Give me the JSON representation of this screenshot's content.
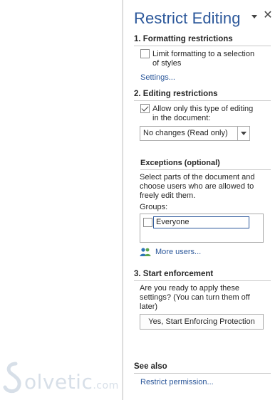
{
  "pane": {
    "title": "Restrict Editing",
    "menu_icon": "chevron-down-icon",
    "close_icon": "close-icon",
    "close_glyph": "✕"
  },
  "formatting": {
    "heading": "1. Formatting restrictions",
    "limit_checked": false,
    "limit_line1": "Limit formatting to a selection",
    "limit_line2": "of styles",
    "settings_link": "Settings..."
  },
  "editing": {
    "heading": "2. Editing restrictions",
    "allow_checked": true,
    "allow_line1": "Allow only this type of editing",
    "allow_line2": "in the document:",
    "dropdown_value": "No changes (Read only)",
    "exceptions_heading": "Exceptions (optional)",
    "exceptions_line1": "Select parts of the document and",
    "exceptions_line2": "choose users who are allowed to",
    "exceptions_line3": "freely edit them.",
    "groups_label": "Groups:",
    "group_everyone": "Everyone",
    "group_everyone_checked": false,
    "more_users_link": "More users...",
    "more_users_icon": "users-icon"
  },
  "enforcement": {
    "heading": "3. Start enforcement",
    "question_line1": "Are you ready to apply these",
    "question_line2": "settings? (You can turn them off",
    "question_line3": "later)",
    "button_label": "Yes, Start Enforcing Protection"
  },
  "see_also": {
    "heading": "See also",
    "link": "Restrict permission..."
  },
  "watermark": {
    "text": "olvetic",
    "suffix": ".com"
  },
  "colors": {
    "accent": "#2b579a",
    "text": "#262626",
    "rule": "#c8c8c8"
  }
}
